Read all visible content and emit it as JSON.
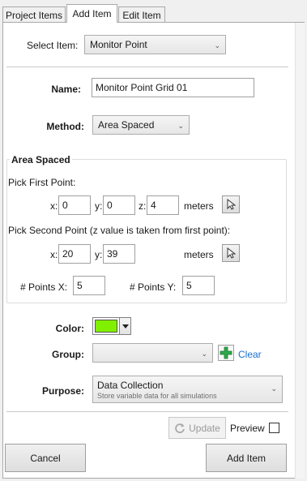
{
  "tabs": [
    {
      "label": "Project Items"
    },
    {
      "label": "Add Item"
    },
    {
      "label": "Edit Item"
    }
  ],
  "select_item": {
    "label": "Select Item:",
    "value": "Monitor Point"
  },
  "name": {
    "label": "Name:",
    "value": "Monitor Point Grid 01"
  },
  "method": {
    "label": "Method:",
    "value": "Area Spaced"
  },
  "area": {
    "title": "Area Spaced",
    "first_point": {
      "label": "Pick First Point:",
      "x": "0",
      "y": "0",
      "z": "4",
      "units": "meters"
    },
    "second_point": {
      "label": "Pick Second Point (z value is taken from first point):",
      "x": "20",
      "y": "39",
      "units": "meters"
    },
    "x_label": "x:",
    "y_label": "y:",
    "z_label": "z:",
    "points_x": {
      "label": "# Points X:",
      "value": "5"
    },
    "points_y": {
      "label": "# Points Y:",
      "value": "5"
    }
  },
  "color": {
    "label": "Color:",
    "swatch": "#80f000"
  },
  "group": {
    "label": "Group:",
    "value": "",
    "clear_label": "Clear"
  },
  "purpose": {
    "label": "Purpose:",
    "title": "Data Collection",
    "subtitle": "Store variable data for all simulations"
  },
  "footer": {
    "update_label": "Update",
    "preview_label": "Preview",
    "cancel_label": "Cancel",
    "add_label": "Add Item"
  },
  "colors": {
    "accent_link": "#1a6fd1",
    "plus_green": "#2fa84a"
  }
}
